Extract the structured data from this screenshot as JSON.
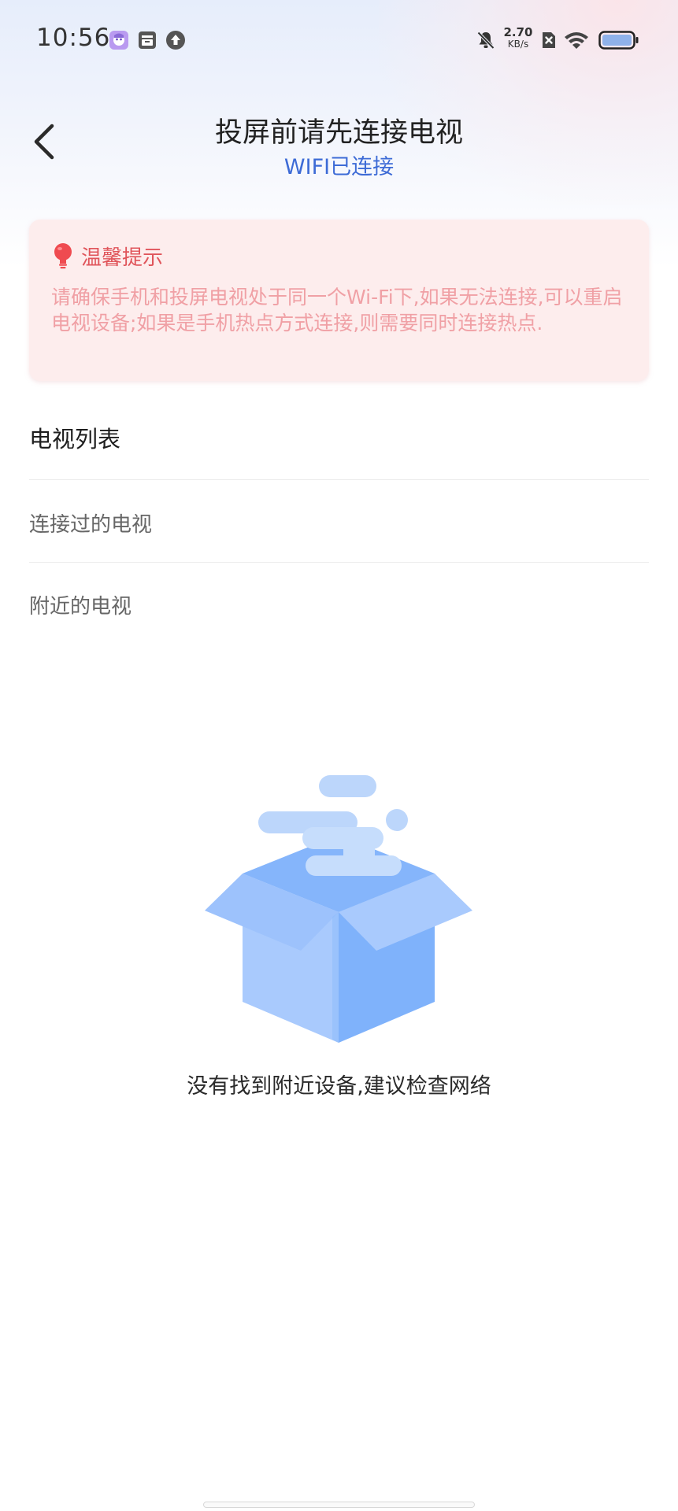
{
  "status_bar": {
    "time": "10:56",
    "net_speed_value": "2.70",
    "net_speed_unit": "KB/s",
    "icons": [
      "app-avatar-icon",
      "archive-icon",
      "upload-icon",
      "mute-bell-icon",
      "sim-off-icon",
      "wifi-icon",
      "battery-icon"
    ]
  },
  "header": {
    "back_icon": "back-arrow-icon",
    "title": "投屏前请先连接电视",
    "subtitle": "WIFI已连接"
  },
  "tip": {
    "icon": "lightbulb-icon",
    "title": "温馨提示",
    "body": "请确保手机和投屏电视处于同一个Wi-Fi下,如果无法连接,可以重启电视设备;如果是手机热点方式连接,则需要同时连接热点."
  },
  "tv_list": {
    "header": "电视列表",
    "connected_label": "连接过的电视",
    "nearby_label": "附近的电视"
  },
  "empty_state": {
    "illustration": "empty-box-icon",
    "message": "没有找到附近设备,建议检查网络"
  },
  "colors": {
    "accent_blue": "#3d6bd6",
    "tip_background": "#fdeded",
    "tip_title": "#e0555b",
    "tip_text": "#f0a0a5",
    "box_blue": "#7fb2fb"
  }
}
